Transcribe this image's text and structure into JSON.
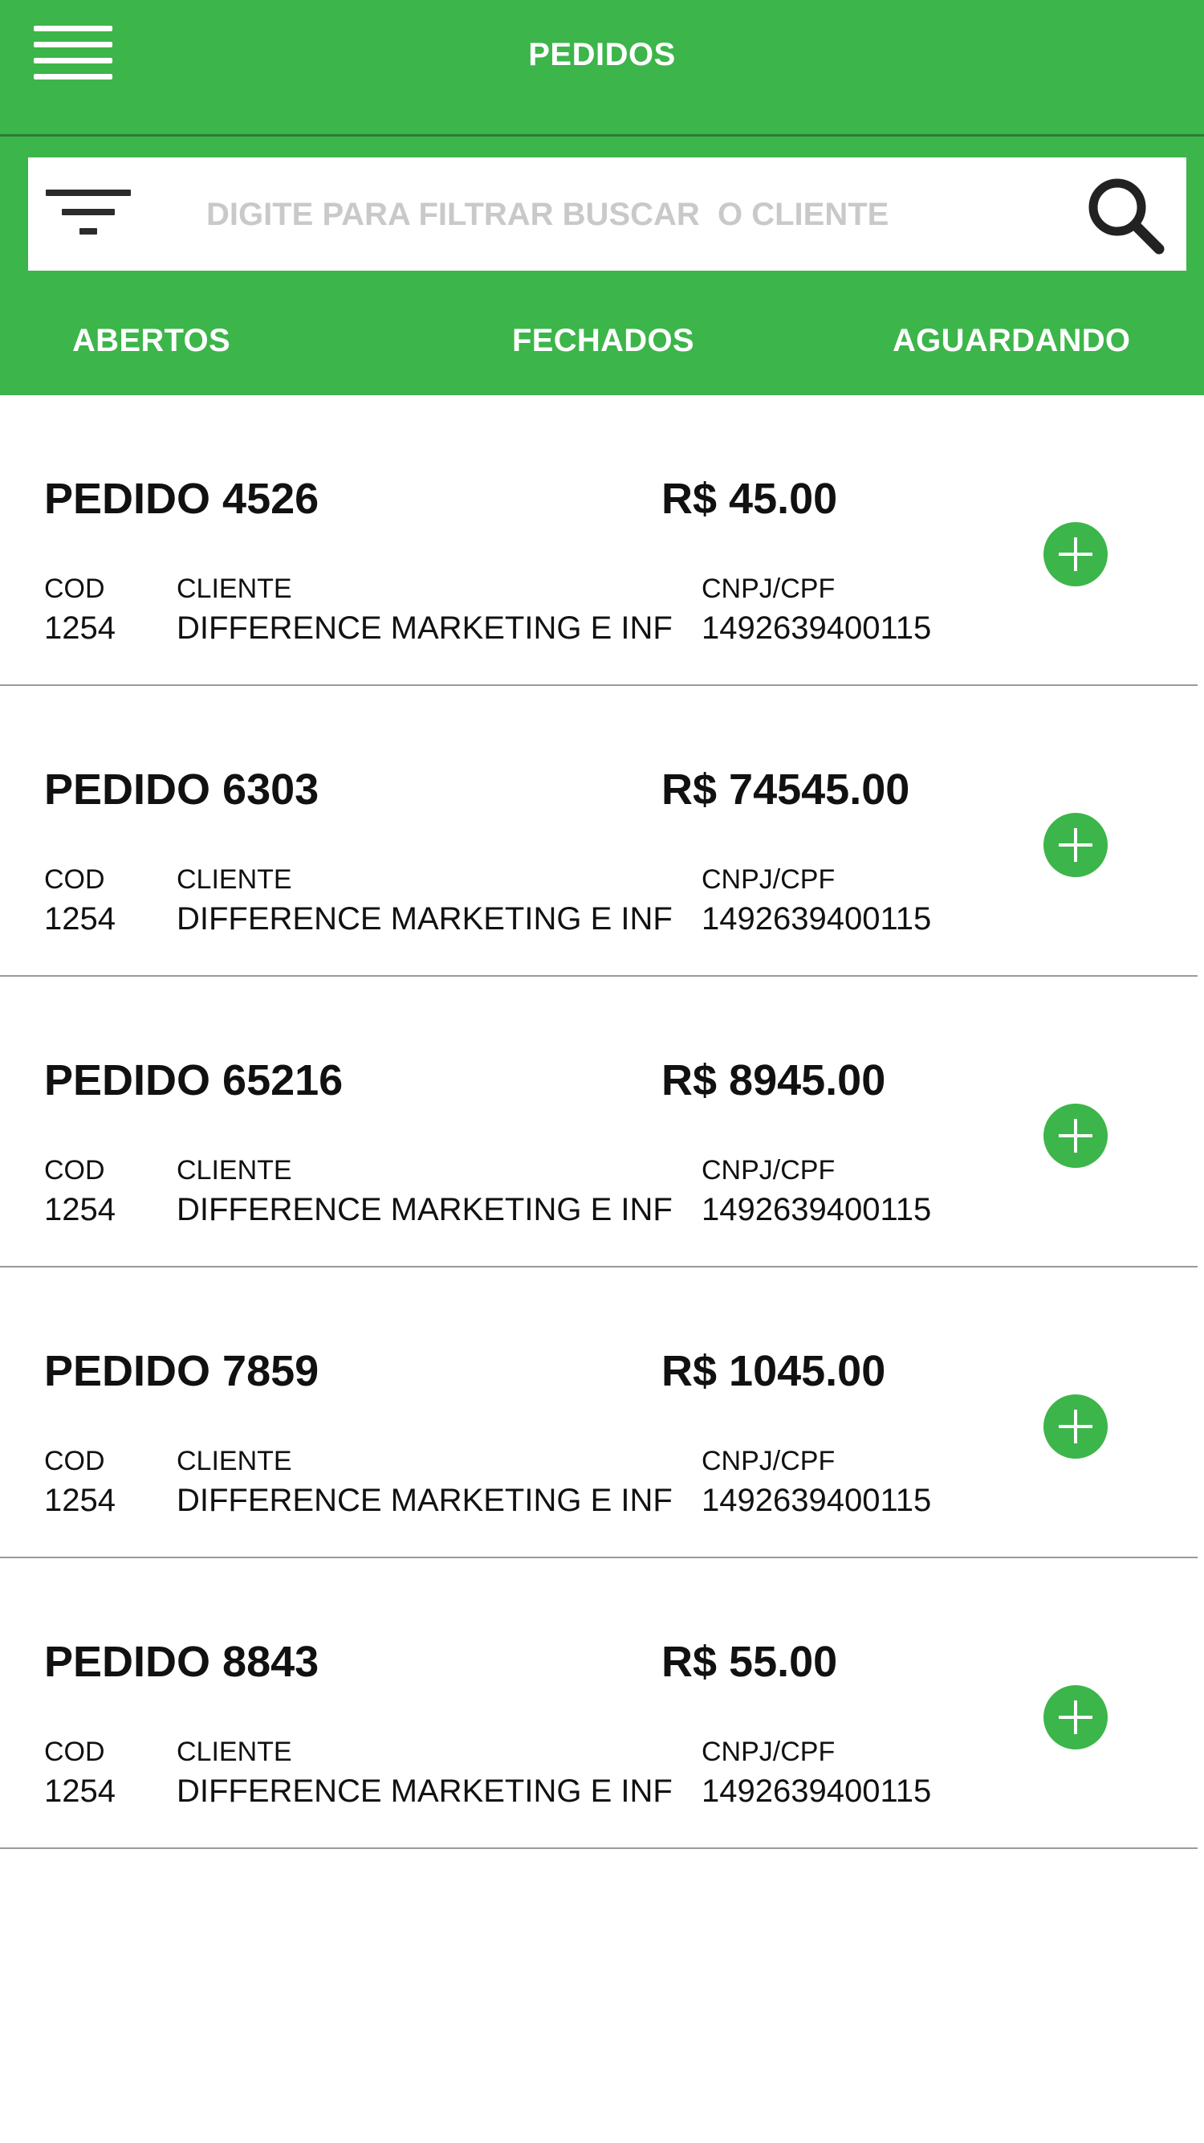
{
  "header": {
    "title": "PEDIDOS",
    "menu_icon": "hamburger-menu-icon"
  },
  "search": {
    "placeholder": "DIGITE PARA FILTRAR BUSCAR  O CLIENTE",
    "value": "",
    "filter_icon": "filter-icon",
    "search_icon": "search-icon"
  },
  "tabs": [
    {
      "label": "ABERTOS"
    },
    {
      "label": "FECHADOS"
    },
    {
      "label": "AGUARDANDO"
    }
  ],
  "colors": {
    "brand_green": "#3cb54a",
    "placeholder": "#c9c9c9",
    "text": "#111111",
    "divider": "#9a9a9a"
  },
  "orders": [
    {
      "title": "PEDIDO 4526",
      "price": "R$ 45.00",
      "cod_label": "COD",
      "cod": "1254",
      "cliente_label": "CLIENTE",
      "cliente": "DIFFERENCE MARKETING E INF",
      "cnpj_label": "CNPJ/CPF",
      "cnpj": "1492639400115"
    },
    {
      "title": "PEDIDO 6303",
      "price": "R$ 74545.00",
      "cod_label": "COD",
      "cod": "1254",
      "cliente_label": "CLIENTE",
      "cliente": "DIFFERENCE MARKETING E INF",
      "cnpj_label": "CNPJ/CPF",
      "cnpj": "1492639400115"
    },
    {
      "title": "PEDIDO 65216",
      "price": "R$ 8945.00",
      "cod_label": "COD",
      "cod": "1254",
      "cliente_label": "CLIENTE",
      "cliente": "DIFFERENCE MARKETING E INF",
      "cnpj_label": "CNPJ/CPF",
      "cnpj": "1492639400115"
    },
    {
      "title": "PEDIDO 7859",
      "price": "R$ 1045.00",
      "cod_label": "COD",
      "cod": "1254",
      "cliente_label": "CLIENTE",
      "cliente": "DIFFERENCE MARKETING E INF",
      "cnpj_label": "CNPJ/CPF",
      "cnpj": "1492639400115"
    },
    {
      "title": "PEDIDO 8843",
      "price": "R$ 55.00",
      "cod_label": "COD",
      "cod": "1254",
      "cliente_label": "CLIENTE",
      "cliente": "DIFFERENCE MARKETING E INF",
      "cnpj_label": "CNPJ/CPF",
      "cnpj": "1492639400115"
    }
  ],
  "add_icon": "plus-circle-icon"
}
